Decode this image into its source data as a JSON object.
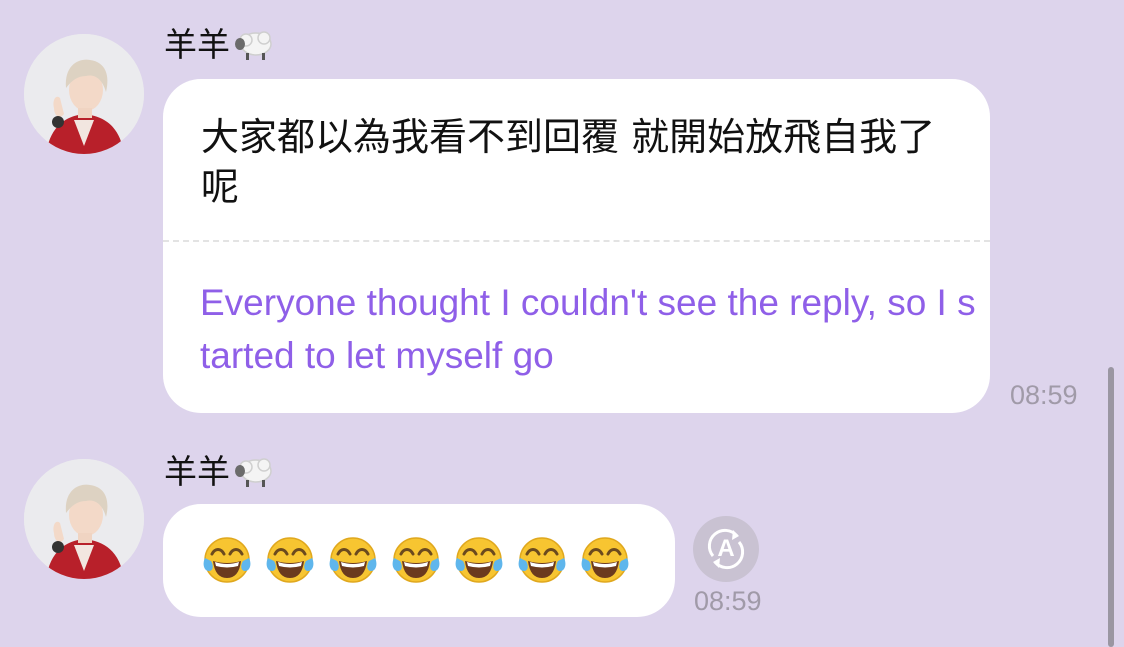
{
  "messages": [
    {
      "sender": "羊羊",
      "original_text": "大家都以為我看不到回覆 就開始放飛自我了呢",
      "translated_text": "Everyone thought I couldn't see the reply, so I started to let myself go",
      "time": "08:59",
      "avatar_icon": "user-avatar-photo",
      "sender_emoji_icon": "sheep-emoji"
    },
    {
      "sender": "羊羊",
      "emojis": [
        "face-with-tears-of-joy",
        "face-with-tears-of-joy",
        "face-with-tears-of-joy",
        "face-with-tears-of-joy",
        "face-with-tears-of-joy",
        "face-with-tears-of-joy",
        "face-with-tears-of-joy"
      ],
      "time": "08:59",
      "avatar_icon": "user-avatar-photo",
      "sender_emoji_icon": "sheep-emoji",
      "translate_button": {
        "icon": "auto-translate-icon",
        "letter": "A"
      }
    }
  ],
  "colors": {
    "background": "#ddd4ec",
    "bubble": "#ffffff",
    "translation_text": "#8f5fe8",
    "timestamp": "#a09aa8"
  }
}
